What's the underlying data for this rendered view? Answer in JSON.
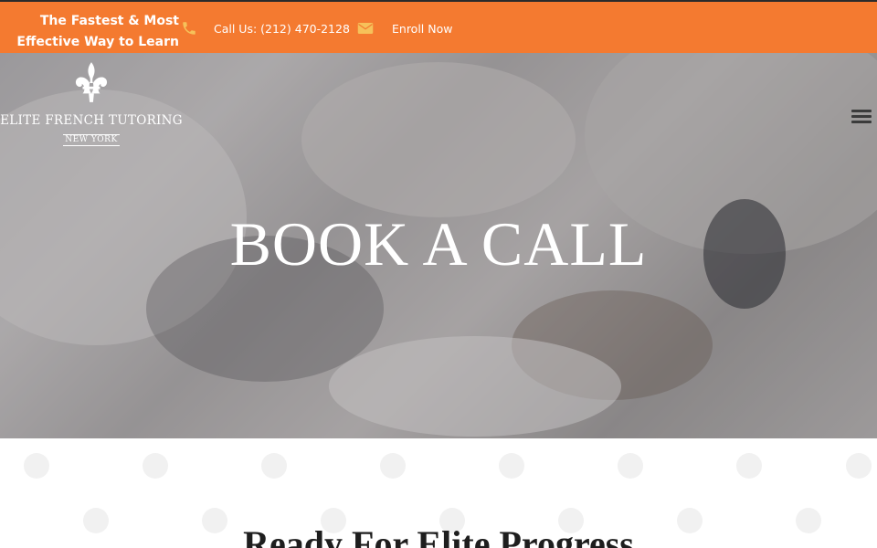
{
  "topbar": {
    "tagline_line1": "The Fastest & Most",
    "tagline_line2": "Effective Way to Learn",
    "phone_label": "Call Us: (212) 470-2128",
    "enroll_label": "Enroll Now",
    "icons": {
      "phone": "phone-icon",
      "enroll": "envelope-icon"
    },
    "colors": {
      "background": "#f47a30",
      "icon": "#f6c15a"
    }
  },
  "logo": {
    "brand": "ELITE FRENCH TUTORING",
    "city": "NEW YORK",
    "icon": "fleur-de-lis-icon"
  },
  "header": {
    "menu_icon": "hamburger-menu-icon"
  },
  "hero": {
    "title": "BOOK A CALL"
  },
  "section": {
    "heading": "Ready For Elite Progress"
  }
}
